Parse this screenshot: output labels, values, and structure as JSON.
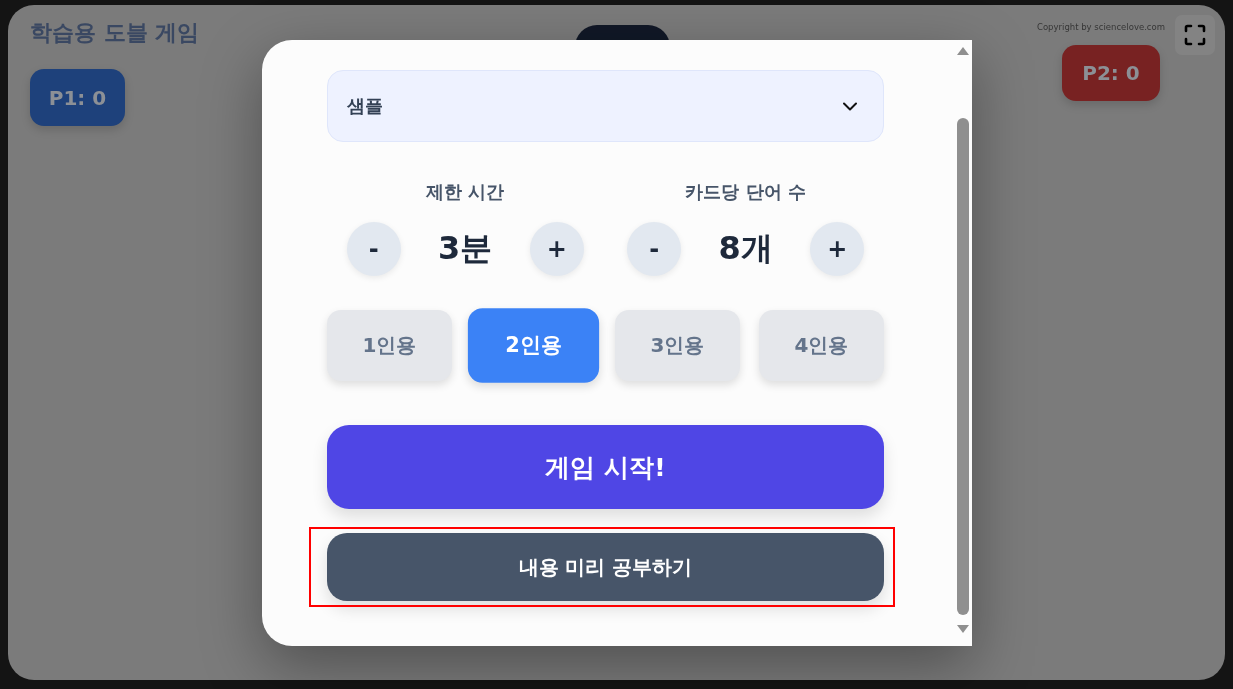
{
  "app": {
    "title": "학습용 도블 게임",
    "copyright": "Copyright by sciencelove.com"
  },
  "scores": [
    {
      "label": "P1: 0",
      "color": "#1e417b"
    },
    {
      "label": "P2: 0",
      "color": "#782222"
    }
  ],
  "modal": {
    "deck_select": {
      "value": "샘플"
    },
    "settings": [
      {
        "label": "제한 시간",
        "value": "3분",
        "decrement": "-",
        "increment": "+"
      },
      {
        "label": "카드당 단어 수",
        "value": "8개",
        "decrement": "-",
        "increment": "+"
      }
    ],
    "player_modes": [
      {
        "label": "1인용",
        "selected": false
      },
      {
        "label": "2인용",
        "selected": true
      },
      {
        "label": "3인용",
        "selected": false
      },
      {
        "label": "4인용",
        "selected": false
      }
    ],
    "actions": [
      {
        "kind": "primary",
        "label": "게임 시작!",
        "highlighted": false
      },
      {
        "kind": "secondary",
        "label": "내용 미리 공부하기",
        "highlighted": true
      }
    ]
  }
}
